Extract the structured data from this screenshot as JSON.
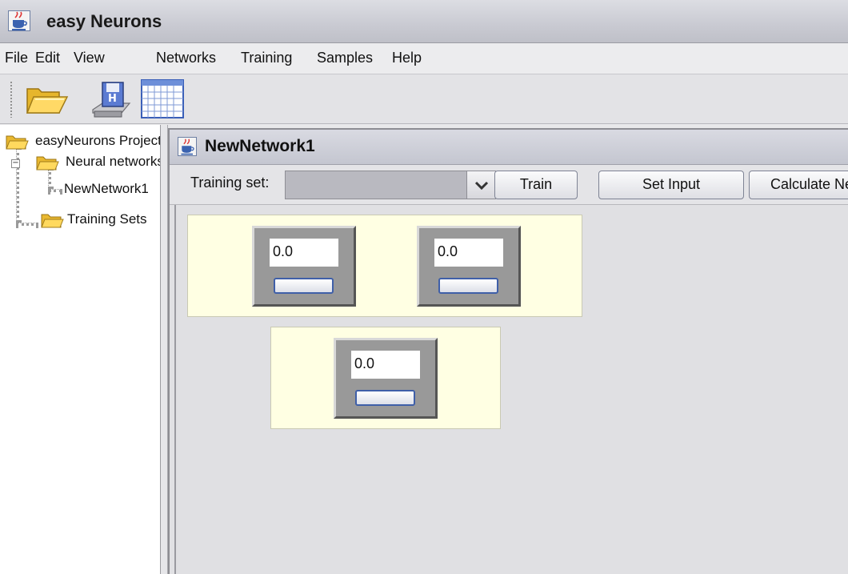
{
  "app": {
    "title": "easy Neurons",
    "icon": "java-cup-icon"
  },
  "menu": {
    "items": [
      "File",
      "Edit",
      "View",
      "Networks",
      "Training",
      "Samples",
      "Help"
    ]
  },
  "toolbar": {
    "buttons": [
      {
        "icon": "open-folder-icon"
      },
      {
        "icon": "save-disk-icon"
      },
      {
        "icon": "grid-table-icon"
      }
    ]
  },
  "tree": {
    "root": "easyNeurons Project",
    "networks_folder": "Neural networks",
    "network_item": "NewNetwork1",
    "training_sets_folder": "Training Sets"
  },
  "network_window": {
    "title": "NewNetwork1",
    "training_set_label": "Training set:",
    "training_set_value": "",
    "train_button": "Train",
    "set_input_button": "Set Input",
    "calculate_button": "Calculate Network"
  },
  "layers": [
    {
      "neurons": [
        {
          "value": "0.0"
        },
        {
          "value": "0.0"
        }
      ]
    },
    {
      "neurons": [
        {
          "value": "0.0"
        }
      ]
    }
  ],
  "colors": {
    "layer_background": "#ffffe3",
    "neuron_body": "#999999",
    "neuron_bar_border": "#3f5fa8"
  }
}
